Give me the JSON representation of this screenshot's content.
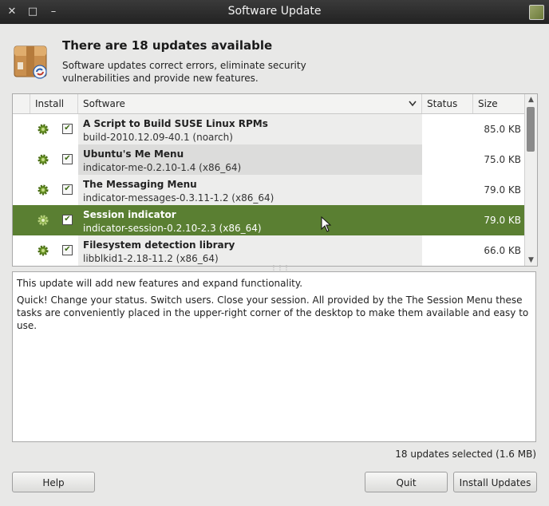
{
  "window": {
    "title": "Software Update",
    "close_glyph": "✕",
    "maximize_glyph": "□",
    "minimize_glyph": "–"
  },
  "header": {
    "title": "There are 18 updates available",
    "description": "Software updates correct errors, eliminate security vulnerabilities and provide new features."
  },
  "columns": {
    "install": "Install",
    "software": "Software",
    "status": "Status",
    "size": "Size"
  },
  "updates": [
    {
      "name": "A Script to Build SUSE Linux RPMs",
      "version": "build-2010.12.09-40.1 (noarch)",
      "size": "85.0 KB",
      "checked": true,
      "selected": false
    },
    {
      "name": "Ubuntu's Me Menu",
      "version": "indicator-me-0.2.10-1.4 (x86_64)",
      "size": "75.0 KB",
      "checked": true,
      "selected": false
    },
    {
      "name": "The Messaging Menu",
      "version": "indicator-messages-0.3.11-1.2 (x86_64)",
      "size": "79.0 KB",
      "checked": true,
      "selected": false
    },
    {
      "name": "Session indicator",
      "version": "indicator-session-0.2.10-2.3 (x86_64)",
      "size": "79.0 KB",
      "checked": true,
      "selected": true
    },
    {
      "name": "Filesystem detection library",
      "version": "libblkid1-2.18-11.2 (x86_64)",
      "size": "66.0 KB",
      "checked": true,
      "selected": false
    }
  ],
  "details": {
    "line1": "This update will add new features and expand functionality.",
    "line2": "Quick! Change your status. Switch users. Close your session. All provided by the The Session Menu these tasks are conveniently placed in the upper-right corner of the desktop to make them available and easy to use."
  },
  "selection_summary": "18 updates selected (1.6 MB)",
  "buttons": {
    "help": "Help",
    "quit": "Quit",
    "install": "Install Updates"
  },
  "colors": {
    "selection": "#5a7f32",
    "titlebar": "#2b2b2b",
    "gear": "#6f9a2a"
  },
  "icons": {
    "app": "package-update-icon",
    "row": "gear-icon",
    "sort": "chevron-down-icon"
  }
}
